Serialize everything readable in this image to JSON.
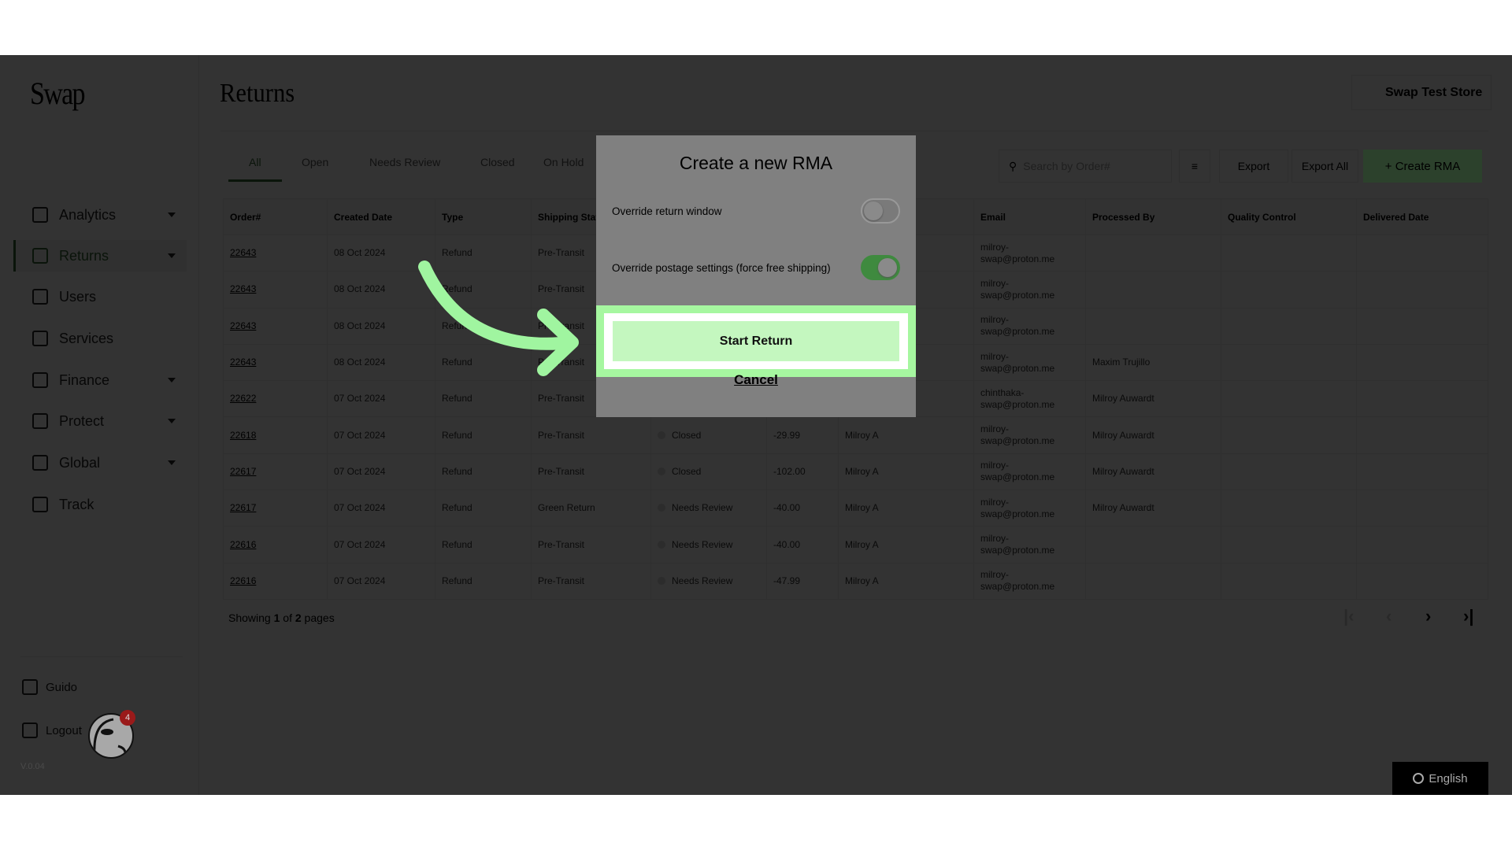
{
  "sidebar": {
    "logo": "Swap",
    "items": [
      {
        "label": "Analytics",
        "icon": "chart-icon",
        "caret": true
      },
      {
        "label": "Returns",
        "icon": "box-icon",
        "caret": true,
        "active": true
      },
      {
        "label": "Users",
        "icon": "user-card-icon",
        "caret": false
      },
      {
        "label": "Services",
        "icon": "grid-dots-icon",
        "caret": false
      },
      {
        "label": "Finance",
        "icon": "bank-icon",
        "caret": true
      },
      {
        "label": "Protect",
        "icon": "shield-icon",
        "caret": true
      },
      {
        "label": "Global",
        "icon": "globe-icon",
        "caret": true
      },
      {
        "label": "Track",
        "icon": "track-icon",
        "caret": false
      }
    ],
    "user": "Guido",
    "logout": "Logout",
    "version": "V.0.04",
    "notification_count": "4"
  },
  "header": {
    "title": "Returns",
    "store": "Swap Test Store"
  },
  "tabs": [
    "All",
    "Open",
    "Needs Review",
    "Closed",
    "On Hold"
  ],
  "toolbar": {
    "search_placeholder": "Search by Order#",
    "export": "Export",
    "export_all": "Export All",
    "create": "+ Create RMA"
  },
  "table": {
    "columns": [
      "Order#",
      "Created Date",
      "Type",
      "Shipping Stat",
      "",
      "",
      "",
      "Email",
      "Processed By",
      "Quality Control",
      "Delivered Date"
    ],
    "rows": [
      [
        "22643",
        "08 Oct 2024",
        "Refund",
        "Pre-Transit",
        "",
        "",
        "",
        "milroy-swap@proton.me",
        "",
        "",
        ""
      ],
      [
        "22643",
        "08 Oct 2024",
        "Refund",
        "Pre-Transit",
        "",
        "",
        "",
        "milroy-swap@proton.me",
        "",
        "",
        ""
      ],
      [
        "22643",
        "08 Oct 2024",
        "Refund",
        "Pre-Transit",
        "",
        "",
        "",
        "milroy-swap@proton.me",
        "",
        "",
        ""
      ],
      [
        "22643",
        "08 Oct 2024",
        "Refund",
        "Pre-Transit",
        "",
        "",
        "",
        "milroy-swap@proton.me",
        "Maxim Trujillo",
        "",
        ""
      ],
      [
        "22622",
        "07 Oct 2024",
        "Refund",
        "Pre-Transit",
        "",
        "",
        "",
        "chinthaka-swap@proton.me",
        "Milroy Auwardt",
        "",
        ""
      ],
      [
        "22618",
        "07 Oct 2024",
        "Refund",
        "Pre-Transit",
        "Closed",
        "-29.99",
        "Milroy A",
        "milroy-swap@proton.me",
        "Milroy Auwardt",
        "",
        ""
      ],
      [
        "22617",
        "07 Oct 2024",
        "Refund",
        "Pre-Transit",
        "Closed",
        "-102.00",
        "Milroy A",
        "milroy-swap@proton.me",
        "Milroy Auwardt",
        "",
        ""
      ],
      [
        "22617",
        "07 Oct 2024",
        "Refund",
        "Green Return",
        "Needs Review",
        "-40.00",
        "Milroy A",
        "milroy-swap@proton.me",
        "Milroy Auwardt",
        "",
        ""
      ],
      [
        "22616",
        "07 Oct 2024",
        "Refund",
        "Pre-Transit",
        "Needs Review",
        "-40.00",
        "Milroy A",
        "milroy-swap@proton.me",
        "",
        "",
        ""
      ],
      [
        "22616",
        "07 Oct 2024",
        "Refund",
        "Pre-Transit",
        "Needs Review",
        "-47.99",
        "Milroy A",
        "milroy-swap@proton.me",
        "",
        "",
        ""
      ]
    ]
  },
  "pagination": {
    "showing": "Showing",
    "current": "1",
    "of": "of",
    "total": "2",
    "pages": "pages"
  },
  "language": "English",
  "modal": {
    "title": "Create a new RMA",
    "option1": {
      "label": "Override return window",
      "on": false
    },
    "option2": {
      "label": "Override postage settings (force free shipping)",
      "on": true
    },
    "start": "Start Return",
    "cancel": "Cancel"
  },
  "colors": {
    "highlight": "#a6f7a0",
    "arrow": "#a0f5a0",
    "toggle_on": "#3f8a3f",
    "primary": "#2d4a2d"
  }
}
